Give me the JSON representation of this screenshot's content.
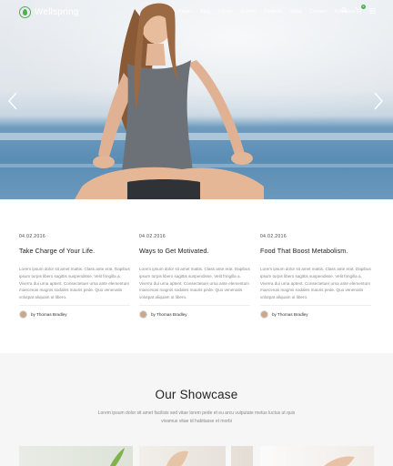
{
  "header": {
    "brand": "Wellspring",
    "nav": [
      "Pages",
      "Blog",
      "Forum",
      "Events",
      "Portfolio",
      "Shop",
      "Contact",
      "Elements"
    ],
    "cart_count": "0",
    "icons": [
      "search-icon",
      "cart-icon",
      "menu-icon"
    ]
  },
  "hero": {
    "prev_arrow": "‹",
    "next_arrow": "›"
  },
  "posts": [
    {
      "date": "04.02.2016",
      "title": "Take Charge of Your Life.",
      "excerpt": "Lorem ipsum dolor sit amet mattis. Class ante erat. Dapibus ipsum turpis libero sagittis suspendisse. Velit fringilla a. Viverra dui urna aptent. Consectetuer urna ante elementum maecenas magnis sodales mauris pede. Quo venenatis volutpat aliquam ut libero.",
      "author": "by Thomas Bradley"
    },
    {
      "date": "04.02.2016",
      "title": "Ways to Get Motivated.",
      "excerpt": "Lorem ipsum dolor sit amet mattis. Class ante erat. Dapibus ipsum turpis libero sagittis suspendisse. Velit fringilla a. Viverra dui urna aptent. Consectetuer urna ante elementum maecenas magnis sodales mauris pede. Quo venenatis volutpat aliquam ut libero.",
      "author": "by Thomas Bradley"
    },
    {
      "date": "04.02.2016",
      "title": "Food That Boost Metabolism.",
      "excerpt": "Lorem ipsum dolor sit amet mattis. Class ante erat. Dapibus ipsum turpis libero sagittis suspendisse. Velit fringilla a. Viverra dui urna aptent. Consectetuer urna ante elementum maecenas magnis sodales mauris pede. Quo venenatis volutpat aliquam ut libero.",
      "author": "by Thomas Bradley"
    }
  ],
  "showcase": {
    "title": "Our Showcase",
    "text": "Lorem ipsum dolor sit amet facilisis sed vitae lorem pede et eu arcu vulputate metus luctus ut quis vivamus vitae id habitasse et morbi"
  },
  "colors": {
    "accent": "#4caf50",
    "showcase_bg": "#f6f6f6"
  }
}
